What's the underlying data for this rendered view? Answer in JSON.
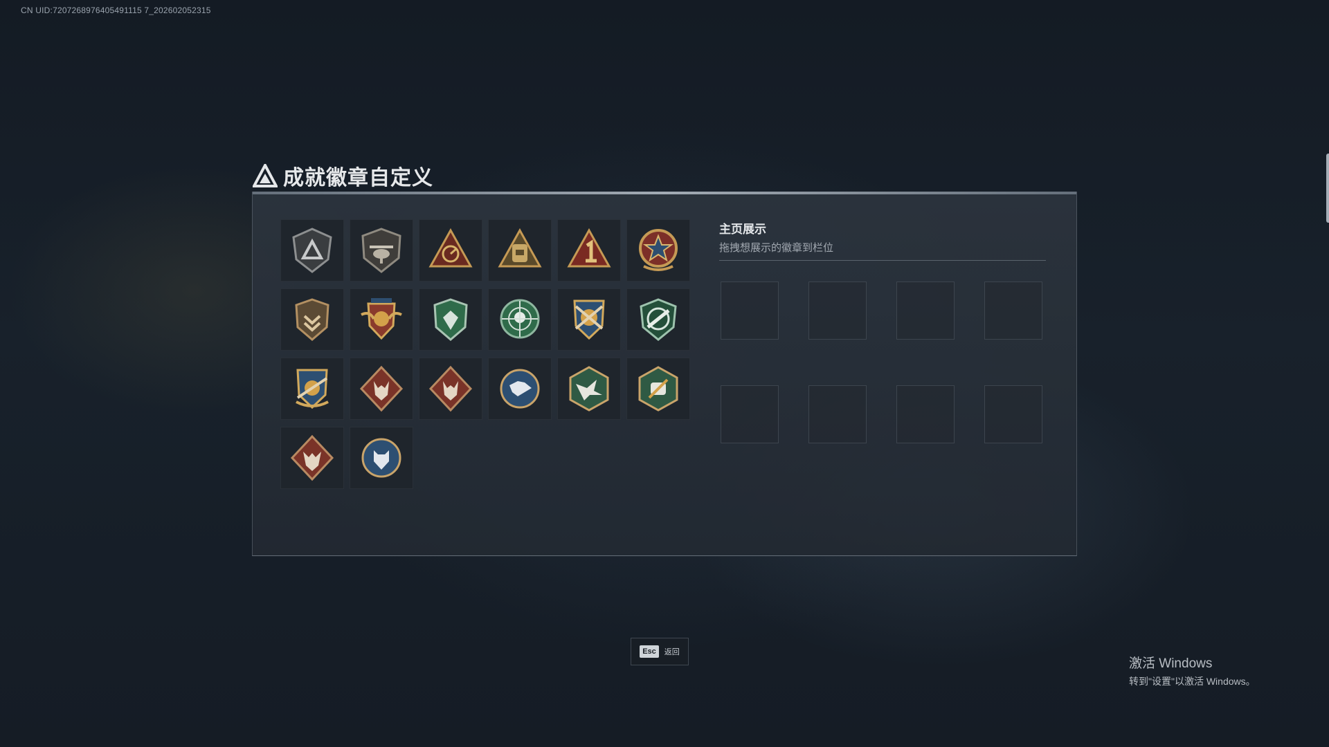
{
  "uid_text": "CN UID:7207268976405491115 7_202602052315",
  "window": {
    "title": "成就徽章自定义"
  },
  "badges": [
    {
      "icon": "delta-shield-badge-icon"
    },
    {
      "icon": "helicopter-badge-icon"
    },
    {
      "icon": "radar-triangle-badge-icon"
    },
    {
      "icon": "backpack-triangle-badge-icon"
    },
    {
      "icon": "number-one-triangle-badge-icon"
    },
    {
      "icon": "star-medal-badge-icon"
    },
    {
      "icon": "chevron-shield-badge-icon"
    },
    {
      "icon": "winged-crest-badge-icon"
    },
    {
      "icon": "green-gem-badge-icon"
    },
    {
      "icon": "skull-crosshair-badge-icon"
    },
    {
      "icon": "crossed-guns-crest-badge-icon"
    },
    {
      "icon": "rifle-shield-badge-icon"
    },
    {
      "icon": "blade-shield-badge-icon"
    },
    {
      "icon": "red-wolf-badge-icon"
    },
    {
      "icon": "red-wolf-badge-icon"
    },
    {
      "icon": "blue-wolf-badge-icon"
    },
    {
      "icon": "hawk-hexagon-badge-icon"
    },
    {
      "icon": "fist-hexagon-badge-icon"
    },
    {
      "icon": "red-wolf-diamond-badge-icon"
    },
    {
      "icon": "blue-tiger-badge-icon"
    }
  ],
  "showcase": {
    "title": "主页展示",
    "subtitle": "拖拽想展示的徽章到栏位",
    "slot_count": 8
  },
  "footer": {
    "esc_key": "Esc",
    "esc_label": "返回"
  },
  "watermark": {
    "line1": "激活 Windows",
    "line2": "转到\"设置\"以激活 Windows。"
  },
  "colors": {
    "background": "#18212b",
    "panel": "#2c343e",
    "gold": "#b8955a",
    "red_badge": "#8a3a2c",
    "green_badge": "#2f6b4a",
    "blue_badge": "#2d4f72"
  }
}
